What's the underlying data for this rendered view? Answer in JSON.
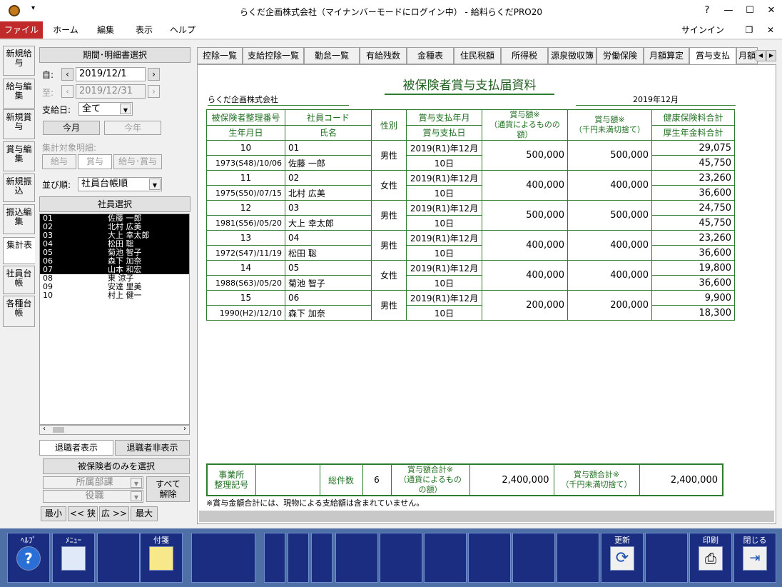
{
  "window": {
    "title": "らくだ企画株式会社（マイナンバーモードにログイン中） - 給料らくだPRO20",
    "help": "?",
    "minimize": "—",
    "maximize": "☐",
    "close": "✕"
  },
  "menu": {
    "file": "ファイル",
    "home": "ホーム",
    "edit": "編集",
    "view": "表示",
    "help": "ヘルプ",
    "signin": "サインイン"
  },
  "sidetabs": [
    "新規給与",
    "給与編集",
    "新規賞与",
    "賞与編集",
    "新規振込",
    "振込編集",
    "集計表",
    "社員台帳",
    "各種台帳"
  ],
  "period": {
    "header": "期間･明細書選択",
    "from_label": "自:",
    "from_value": "2019/12/1",
    "to_label": "至:",
    "to_value": "2019/12/31",
    "payday_label": "支給日:",
    "payday_value": "全て",
    "this_month": "今月",
    "this_year": "今年",
    "target_label": "集計対象明細:",
    "t_salary": "給与",
    "t_bonus": "賞与",
    "t_both": "給与･賞与",
    "sort_label": "並び順:",
    "sort_value": "社員台帳順",
    "emp_select": "社員選択"
  },
  "employees": [
    {
      "code": "01",
      "name": "佐藤 一郎",
      "selected": true
    },
    {
      "code": "02",
      "name": "北村 広美",
      "selected": true
    },
    {
      "code": "03",
      "name": "大上 幸太郎",
      "selected": true
    },
    {
      "code": "04",
      "name": "松田 聡",
      "selected": true
    },
    {
      "code": "05",
      "name": "菊池 智子",
      "selected": true
    },
    {
      "code": "06",
      "name": "森下 加奈",
      "selected": true
    },
    {
      "code": "07",
      "name": "山本 和宏",
      "selected": true
    },
    {
      "code": "08",
      "name": "東 涼子",
      "selected": false
    },
    {
      "code": "09",
      "name": "安達 里美",
      "selected": false
    },
    {
      "code": "10",
      "name": "村上 健一",
      "selected": false
    }
  ],
  "left_bottom": {
    "retired_show": "退職者表示",
    "retired_hide": "退職者非表示",
    "insured_only": "被保険者のみを選択",
    "dept": "所属部課",
    "position": "役職",
    "all_release": "すべて解除",
    "min": "最小",
    "narrow": "<< 狭",
    "wide": "広 >>",
    "max": "最大"
  },
  "tabs": [
    "控除一覧",
    "支給控除一覧",
    "勤怠一覧",
    "有給残数",
    "金種表",
    "住民税額",
    "所得税",
    "源泉徴収簿",
    "労働保険",
    "月額算定",
    "賞与支払",
    "月額"
  ],
  "doc": {
    "title": "被保険者賞与支払届資料",
    "company": "らくだ企画株式会社",
    "period": "2019年12月",
    "headers": {
      "no": "被保険者整理番号",
      "birth": "生年月日",
      "code": "社員コード",
      "name": "氏名",
      "sex": "性別",
      "ym": "賞与支払年月",
      "day": "賞与支払日",
      "amt1": "賞与額※",
      "amt1b": "（通貨によるものの額）",
      "amt2": "賞与額※",
      "amt2b": "（千円未満切捨て）",
      "health": "健康保険料合計",
      "pension": "厚生年金料合計"
    },
    "rows": [
      {
        "no": "10",
        "birth": "1973(S48)/10/06",
        "code": "01",
        "name": "佐藤 一郎",
        "sex": "男性",
        "ym": "2019(R1)年12月",
        "day": "10日",
        "amt1": "500,000",
        "amt2": "500,000",
        "health": "29,075",
        "pension": "45,750"
      },
      {
        "no": "11",
        "birth": "1975(S50)/07/15",
        "code": "02",
        "name": "北村 広美",
        "sex": "女性",
        "ym": "2019(R1)年12月",
        "day": "10日",
        "amt1": "400,000",
        "amt2": "400,000",
        "health": "23,260",
        "pension": "36,600"
      },
      {
        "no": "12",
        "birth": "1981(S56)/05/20",
        "code": "03",
        "name": "大上 幸太郎",
        "sex": "男性",
        "ym": "2019(R1)年12月",
        "day": "10日",
        "amt1": "500,000",
        "amt2": "500,000",
        "health": "24,750",
        "pension": "45,750"
      },
      {
        "no": "13",
        "birth": "1972(S47)/11/19",
        "code": "04",
        "name": "松田 聡",
        "sex": "男性",
        "ym": "2019(R1)年12月",
        "day": "10日",
        "amt1": "400,000",
        "amt2": "400,000",
        "health": "23,260",
        "pension": "36,600"
      },
      {
        "no": "14",
        "birth": "1988(S63)/05/20",
        "code": "05",
        "name": "菊池 智子",
        "sex": "女性",
        "ym": "2019(R1)年12月",
        "day": "10日",
        "amt1": "400,000",
        "amt2": "400,000",
        "health": "19,800",
        "pension": "36,600"
      },
      {
        "no": "15",
        "birth": "1990(H2)/12/10",
        "code": "06",
        "name": "森下 加奈",
        "sex": "男性",
        "ym": "2019(R1)年12月",
        "day": "10日",
        "amt1": "200,000",
        "amt2": "200,000",
        "health": "9,900",
        "pension": "18,300"
      }
    ],
    "totals": {
      "office_label": "事業所\n整理記号",
      "count_label": "総件数",
      "count": "6",
      "sum1_label": "賞与額合計※",
      "sum1_sub": "（通貨によるものの額）",
      "sum1": "2,400,000",
      "sum2_label": "賞与額合計※",
      "sum2_sub": "（千円未満切捨て）",
      "sum2": "2,400,000"
    },
    "note": "※賞与金額合計には、現物による支給額は含まれていません。"
  },
  "fkeys": {
    "help": "ﾍﾙﾌﾟ",
    "menu": "ﾒﾆｭｰ",
    "tag": "付箋",
    "refresh": "更新",
    "print": "印刷",
    "close": "閉じる"
  }
}
